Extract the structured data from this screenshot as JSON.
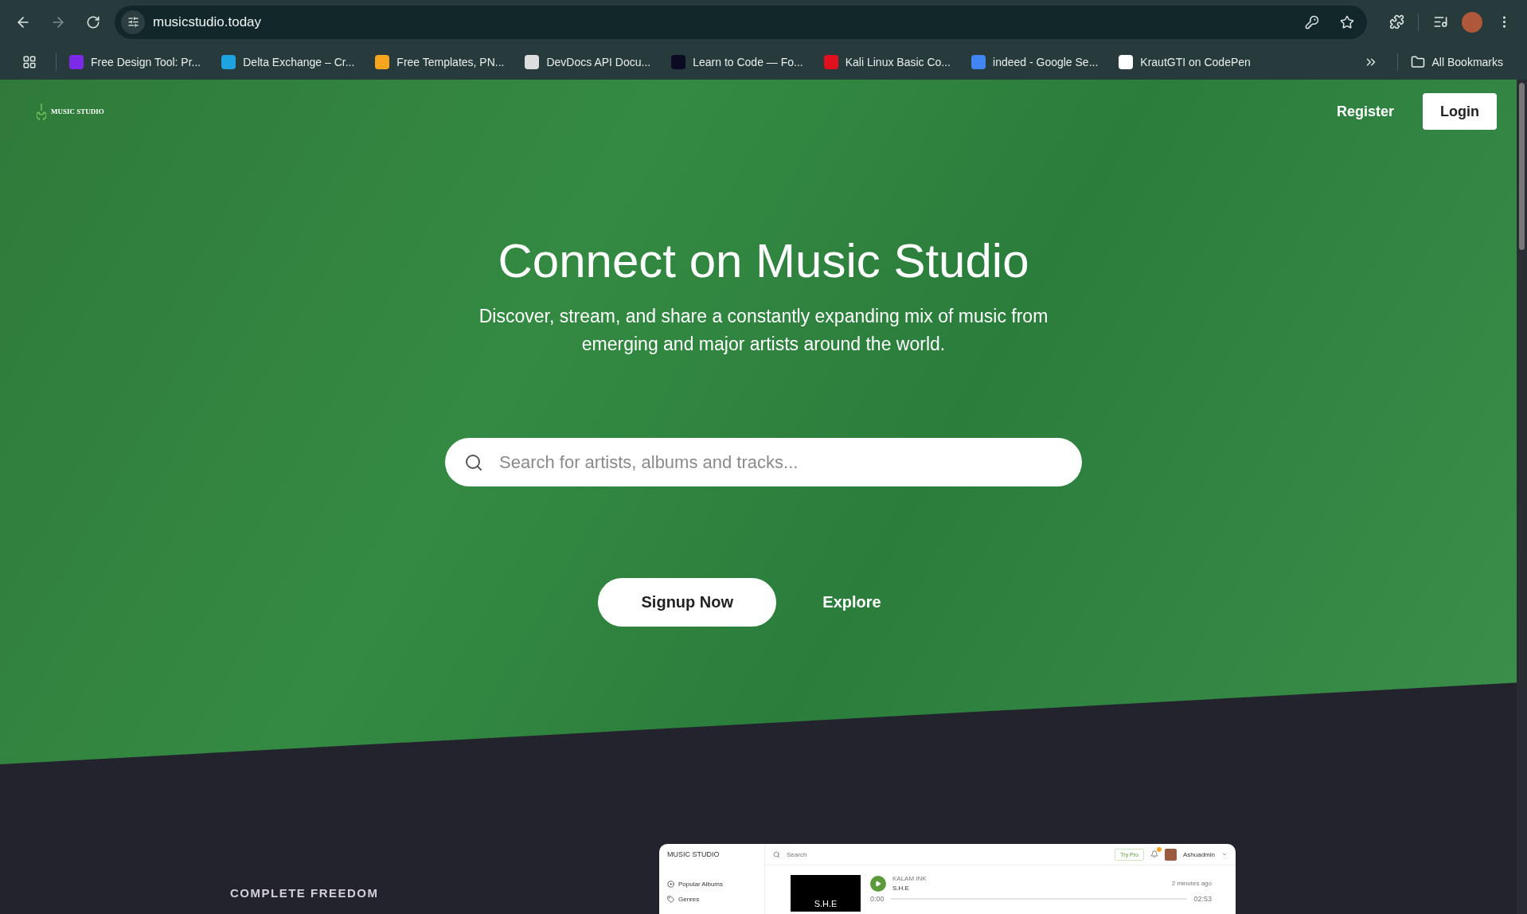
{
  "browser": {
    "url": "musicstudio.today",
    "bookmarks": [
      {
        "label": "Free Design Tool: Pr...",
        "color": "#7d2ae8"
      },
      {
        "label": "Delta Exchange – Cr...",
        "color": "#1fa2e0"
      },
      {
        "label": "Free Templates, PN...",
        "color": "#f7a51c"
      },
      {
        "label": "DevDocs API Docu...",
        "color": "#dddddd"
      },
      {
        "label": "Learn to Code — Fo...",
        "color": "#0a0a23"
      },
      {
        "label": "Kali Linux Basic Co...",
        "color": "#e0101f"
      },
      {
        "label": "indeed - Google Se...",
        "color": "#4285f4"
      },
      {
        "label": "KrautGTI on CodePen",
        "color": "#ffffff"
      }
    ],
    "all_bookmarks": "All Bookmarks"
  },
  "nav": {
    "logo": "MUSIC STUDIO",
    "register": "Register",
    "login": "Login"
  },
  "hero": {
    "title": "Connect on Music Studio",
    "subtitle": "Discover, stream, and share a constantly expanding mix of music from emerging and major artists around the world.",
    "search": {
      "placeholder": "Search for artists, albums and tracks..."
    },
    "signup": "Signup Now",
    "explore": "Explore"
  },
  "feature": {
    "eyebrow": "COMPLETE FREEDOM",
    "preview": {
      "logo": "MUSIC STUDIO",
      "search": "Search",
      "try_pro": "Try Pro",
      "user": "Ashuadmin",
      "sidebar": [
        {
          "label": "Popular Albums",
          "kind": "disc"
        },
        {
          "label": "Genres",
          "kind": "tag"
        }
      ],
      "track": {
        "cover": "S.H.E",
        "artist": "KALAM INK",
        "title": "S.H.E",
        "time": "2 minutes ago",
        "start": "0:00",
        "end": "02:53"
      }
    }
  }
}
